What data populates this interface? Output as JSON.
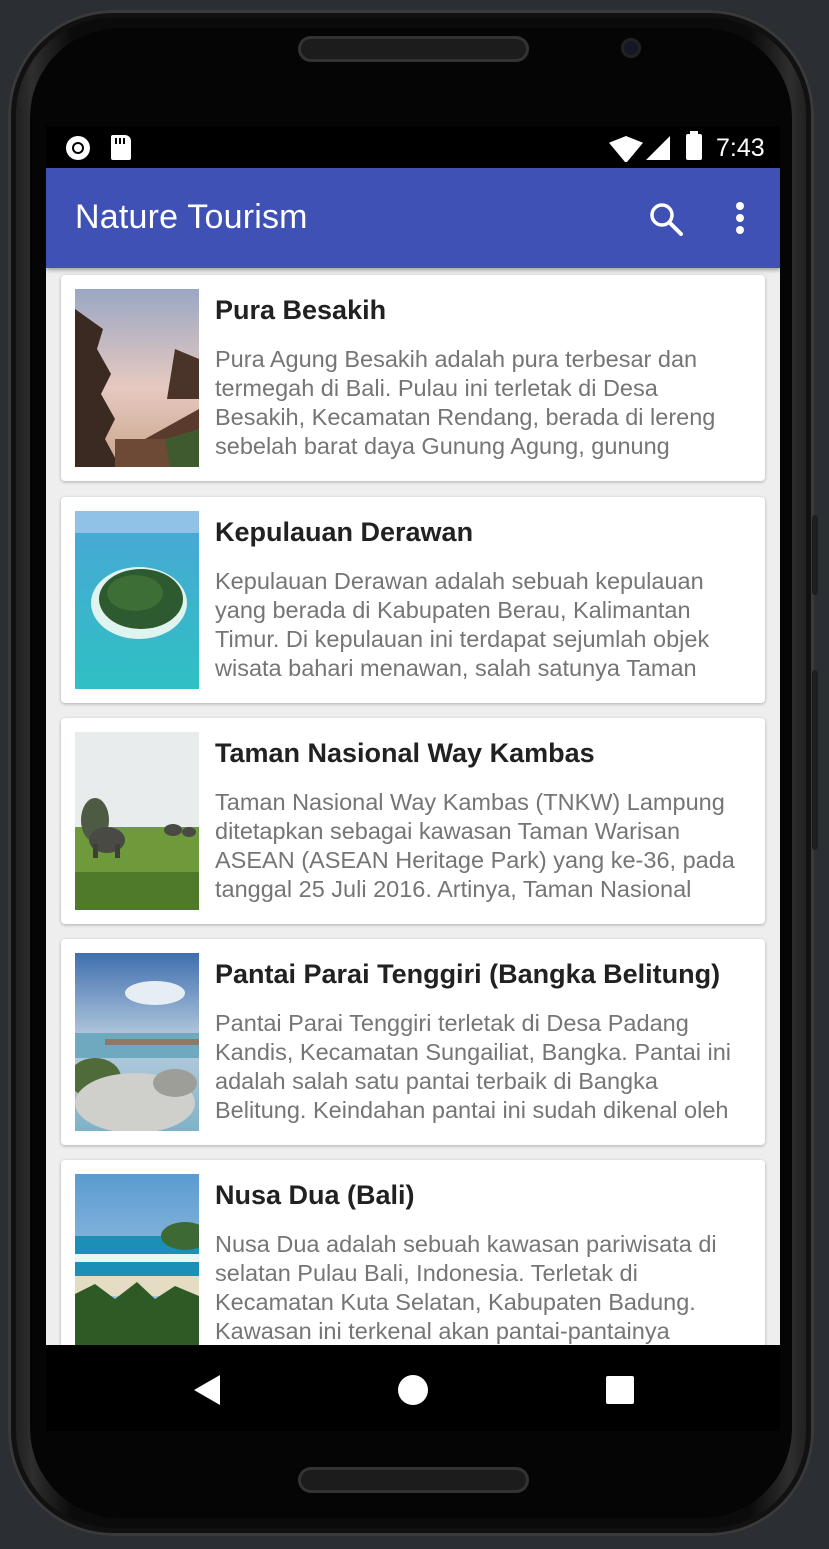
{
  "status_bar": {
    "time": "7:43"
  },
  "app_bar": {
    "title": "Nature Tourism"
  },
  "icons": {
    "search": "search-icon",
    "more": "more-vert-icon",
    "back": "back-icon",
    "home": "home-icon",
    "recents": "recents-icon"
  },
  "colors": {
    "primary": "#3f51b5",
    "title_text": "#212121",
    "body_text": "#757575"
  },
  "places": [
    {
      "name": "Pura Besakih",
      "description": "Pura Agung Besakih adalah pura terbesar dan termegah di Bali. Pulau ini terletak di Desa Besakih, Kecamatan Rendang, berada di lereng sebelah barat daya Gunung Agung, gunung tertinggi di Bali. Pura Agung Besakih"
    },
    {
      "name": "Kepulauan Derawan",
      "description": "Kepulauan Derawan adalah sebuah kepulauan yang berada di Kabupaten Berau, Kalimantan Timur. Di kepulauan ini terdapat sejumlah objek wisata bahari menawan, salah satunya Taman Bawah Laut yang diminati wisatawan"
    },
    {
      "name": "Taman Nasional Way Kambas",
      "description": "Taman Nasional Way Kambas (TNKW) Lampung ditetapkan sebagai kawasan Taman Warisan ASEAN (ASEAN Heritage Park) yang ke-36, pada tanggal 25 Juli 2016. Artinya, Taman Nasional Way Kambas kini menjadi Taman"
    },
    {
      "name": "Pantai Parai Tenggiri (Bangka Belitung)",
      "description": "Pantai Parai Tenggiri terletak di Desa Padang Kandis, Kecamatan Sungailiat, Bangka. Pantai ini adalah salah satu pantai terbaik di Bangka Belitung. Keindahan pantai ini sudah dikenal oleh wisatawan Bangka Belitung maupun luar"
    },
    {
      "name": "Nusa Dua (Bali)",
      "description": "Nusa Dua adalah sebuah kawasan pariwisata di selatan Pulau Bali, Indonesia. Terletak di Kecamatan Kuta Selatan, Kabupaten Badung. Kawasan ini terkenal akan pantai-pantainya"
    }
  ]
}
